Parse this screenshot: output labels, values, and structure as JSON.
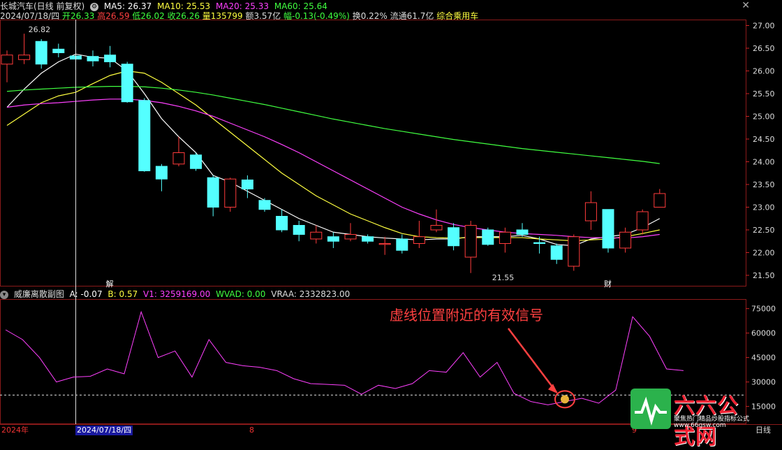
{
  "header": {
    "stock": "长城汽车(日线 前复权)",
    "ma5": "MA5: 26.37",
    "ma10": "MA10: 25.53",
    "ma20": "MA20: 25.33",
    "ma60": "MA60: 25.64",
    "date": "2024/07/18/四",
    "open": "开26.33",
    "high": "高26.59",
    "low": "低26.02",
    "close": "收26.26",
    "volume": "量135799",
    "amount": "额3.57亿",
    "change": "幅-0.13(-0.49%)",
    "turnover": "换0.22%",
    "float_cap": "流通61.7亿",
    "sector": "综合乘用车"
  },
  "sub_header": {
    "name": "威廉离散副图",
    "a": "A: -0.07",
    "b": "B: 0.57",
    "v1": "V1: 3259169.00",
    "wvad": "WVAD: 0.00",
    "vraa": "VRAA: 2332823.00"
  },
  "annotation": "虚线位置附近的有效信号",
  "x_axis": {
    "left": "2024年",
    "cursor": "2024/07/18/四",
    "mid": "8",
    "right": "9",
    "period": "日线"
  },
  "logo": {
    "name": "六六公式网",
    "sub": "聚焦热门精品炒股指标公式",
    "url": "www.66gsw.com"
  },
  "colors": {
    "up": "#ff3b3b",
    "down": "#54ffff",
    "ma5": "#ffffff",
    "ma10": "#ffff40",
    "ma20": "#ff40ff",
    "ma60": "#40ff40",
    "sub_line": "#ff40ff"
  },
  "chart_data": [
    {
      "type": "candlestick",
      "title": "长城汽车(日线 前复权)",
      "ylim": [
        21.3,
        27.1
      ],
      "y_ticks": [
        "27.00",
        "26.50",
        "26.00",
        "25.50",
        "25.00",
        "24.50",
        "24.00",
        "23.50",
        "23.00",
        "22.50",
        "22.00",
        "21.50"
      ],
      "annotations": [
        {
          "text": "26.82",
          "index": 1
        },
        {
          "text": "21.55",
          "index": 28
        },
        {
          "text": "解",
          "index": 6
        },
        {
          "text": "财",
          "index": 35
        }
      ],
      "candles": [
        {
          "o": 26.15,
          "h": 26.45,
          "l": 25.75,
          "c": 26.35
        },
        {
          "o": 26.25,
          "h": 26.82,
          "l": 26.15,
          "c": 26.35
        },
        {
          "o": 26.65,
          "h": 26.7,
          "l": 26.05,
          "c": 26.15
        },
        {
          "o": 26.48,
          "h": 26.6,
          "l": 26.3,
          "c": 26.4
        },
        {
          "o": 26.33,
          "h": 26.59,
          "l": 26.02,
          "c": 26.26
        },
        {
          "o": 26.32,
          "h": 26.45,
          "l": 26.1,
          "c": 26.22
        },
        {
          "o": 26.35,
          "h": 26.55,
          "l": 26.08,
          "c": 26.2
        },
        {
          "o": 26.15,
          "h": 26.2,
          "l": 25.3,
          "c": 25.32
        },
        {
          "o": 25.35,
          "h": 25.4,
          "l": 23.78,
          "c": 23.8
        },
        {
          "o": 23.9,
          "h": 23.95,
          "l": 23.35,
          "c": 23.62
        },
        {
          "o": 23.95,
          "h": 24.55,
          "l": 23.9,
          "c": 24.2
        },
        {
          "o": 24.15,
          "h": 24.2,
          "l": 23.8,
          "c": 23.85
        },
        {
          "o": 23.65,
          "h": 23.7,
          "l": 22.8,
          "c": 23.0
        },
        {
          "o": 23.0,
          "h": 23.65,
          "l": 22.9,
          "c": 23.62
        },
        {
          "o": 23.6,
          "h": 23.7,
          "l": 23.2,
          "c": 23.4
        },
        {
          "o": 23.15,
          "h": 23.2,
          "l": 22.9,
          "c": 22.95
        },
        {
          "o": 22.8,
          "h": 22.95,
          "l": 22.45,
          "c": 22.5
        },
        {
          "o": 22.6,
          "h": 22.7,
          "l": 22.25,
          "c": 22.4
        },
        {
          "o": 22.3,
          "h": 22.6,
          "l": 22.2,
          "c": 22.45
        },
        {
          "o": 22.35,
          "h": 22.45,
          "l": 22.1,
          "c": 22.25
        },
        {
          "o": 22.3,
          "h": 22.65,
          "l": 22.25,
          "c": 22.4
        },
        {
          "o": 22.35,
          "h": 22.4,
          "l": 22.2,
          "c": 22.25
        },
        {
          "o": 22.18,
          "h": 22.35,
          "l": 21.95,
          "c": 22.2
        },
        {
          "o": 22.3,
          "h": 22.4,
          "l": 21.98,
          "c": 22.05
        },
        {
          "o": 22.2,
          "h": 22.7,
          "l": 22.1,
          "c": 22.35
        },
        {
          "o": 22.5,
          "h": 22.95,
          "l": 22.45,
          "c": 22.6
        },
        {
          "o": 22.55,
          "h": 22.65,
          "l": 22.05,
          "c": 22.15
        },
        {
          "o": 21.9,
          "h": 22.7,
          "l": 21.55,
          "c": 22.6
        },
        {
          "o": 22.5,
          "h": 22.55,
          "l": 22.15,
          "c": 22.18
        },
        {
          "o": 22.2,
          "h": 22.55,
          "l": 22.0,
          "c": 22.45
        },
        {
          "o": 22.5,
          "h": 22.65,
          "l": 22.35,
          "c": 22.4
        },
        {
          "o": 22.22,
          "h": 22.35,
          "l": 21.98,
          "c": 22.2
        },
        {
          "o": 22.15,
          "h": 22.2,
          "l": 21.75,
          "c": 21.85
        },
        {
          "o": 21.7,
          "h": 22.4,
          "l": 21.6,
          "c": 22.35
        },
        {
          "o": 22.7,
          "h": 23.35,
          "l": 22.5,
          "c": 23.1
        },
        {
          "o": 22.95,
          "h": 22.95,
          "l": 22.0,
          "c": 22.1
        },
        {
          "o": 22.1,
          "h": 22.55,
          "l": 22.0,
          "c": 22.45
        },
        {
          "o": 22.5,
          "h": 22.95,
          "l": 22.4,
          "c": 22.9
        },
        {
          "o": 23.0,
          "h": 23.4,
          "l": 23.0,
          "c": 23.3
        }
      ],
      "series": [
        {
          "name": "MA5",
          "values": [
            25.2,
            25.6,
            25.95,
            26.2,
            26.37,
            26.3,
            26.28,
            26.0,
            25.5,
            24.95,
            24.55,
            24.2,
            23.7,
            23.55,
            23.35,
            23.15,
            22.95,
            22.75,
            22.6,
            22.45,
            22.4,
            22.35,
            22.32,
            22.3,
            22.28,
            22.3,
            22.3,
            22.35,
            22.35,
            22.35,
            22.38,
            22.3,
            22.18,
            22.15,
            22.3,
            22.35,
            22.4,
            22.55,
            22.75
          ]
        },
        {
          "name": "MA10",
          "values": [
            24.8,
            25.05,
            25.3,
            25.45,
            25.53,
            25.72,
            25.9,
            26.0,
            25.95,
            25.75,
            25.5,
            25.25,
            24.95,
            24.65,
            24.35,
            24.05,
            23.75,
            23.5,
            23.25,
            23.05,
            22.85,
            22.7,
            22.55,
            22.42,
            22.35,
            22.33,
            22.32,
            22.33,
            22.33,
            22.33,
            22.33,
            22.3,
            22.28,
            22.26,
            22.28,
            22.3,
            22.35,
            22.42,
            22.5
          ]
        },
        {
          "name": "MA20",
          "values": [
            25.2,
            25.25,
            25.28,
            25.3,
            25.33,
            25.36,
            25.38,
            25.38,
            25.35,
            25.3,
            25.22,
            25.12,
            25.0,
            24.85,
            24.7,
            24.55,
            24.38,
            24.2,
            24.0,
            23.8,
            23.6,
            23.4,
            23.2,
            23.0,
            22.85,
            22.72,
            22.62,
            22.55,
            22.5,
            22.45,
            22.42,
            22.4,
            22.38,
            22.35,
            22.33,
            22.33,
            22.32,
            22.35,
            22.4
          ]
        },
        {
          "name": "MA60",
          "values": [
            25.55,
            25.58,
            25.6,
            25.62,
            25.64,
            25.65,
            25.66,
            25.66,
            25.65,
            25.62,
            25.58,
            25.53,
            25.47,
            25.4,
            25.33,
            25.26,
            25.18,
            25.1,
            25.02,
            24.94,
            24.87,
            24.8,
            24.73,
            24.67,
            24.61,
            24.55,
            24.49,
            24.44,
            24.39,
            24.34,
            24.29,
            24.25,
            24.21,
            24.17,
            24.13,
            24.09,
            24.05,
            24.01,
            23.96
          ]
        }
      ]
    },
    {
      "type": "line",
      "title": "威廉离散副图",
      "ylim": [
        5000,
        80000
      ],
      "y_ticks": [
        "75000",
        "60000",
        "45000",
        "30000",
        "15000"
      ],
      "dashed_level": 22000,
      "signal_index": 33,
      "series": [
        {
          "name": "VRAA",
          "values": [
            62000,
            56000,
            45000,
            30000,
            33000,
            33500,
            38000,
            35000,
            73000,
            45000,
            49000,
            33000,
            56000,
            42000,
            40000,
            39000,
            37000,
            32000,
            29000,
            28500,
            28000,
            22500,
            28000,
            26000,
            29000,
            37000,
            36000,
            48000,
            33000,
            42000,
            23000,
            18000,
            16000,
            18000,
            20000,
            17000,
            25000,
            70000,
            58000,
            38000,
            37000
          ]
        }
      ]
    }
  ]
}
